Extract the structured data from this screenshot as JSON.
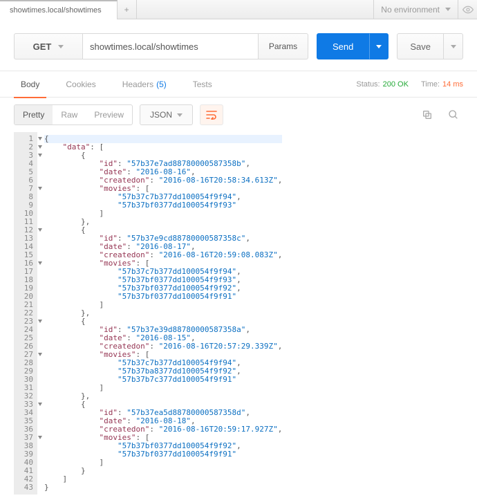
{
  "tab": {
    "title": "showtimes.local/showtimes"
  },
  "env": {
    "label": "No environment"
  },
  "request": {
    "method": "GET",
    "url": "showtimes.local/showtimes",
    "params": "Params",
    "send": "Send",
    "save": "Save"
  },
  "response_tabs": {
    "body": "Body",
    "cookies": "Cookies",
    "headers": "Headers",
    "headers_count": "(5)",
    "tests": "Tests"
  },
  "status": {
    "label": "Status:",
    "value": "200 OK",
    "time_label": "Time:",
    "time_value": "14 ms"
  },
  "viewer": {
    "pretty": "Pretty",
    "raw": "Raw",
    "preview": "Preview",
    "format": "JSON"
  },
  "payload": {
    "data": [
      {
        "id": "57b37e7ad88780000587358b",
        "date": "2016-08-16",
        "createdon": "2016-08-16T20:58:34.613Z",
        "movies": [
          "57b37c7b377dd100054f9f94",
          "57b37bf0377dd100054f9f93"
        ]
      },
      {
        "id": "57b37e9cd88780000587358c",
        "date": "2016-08-17",
        "createdon": "2016-08-16T20:59:08.083Z",
        "movies": [
          "57b37c7b377dd100054f9f94",
          "57b37bf0377dd100054f9f93",
          "57b37bf0377dd100054f9f92",
          "57b37bf0377dd100054f9f91"
        ]
      },
      {
        "id": "57b37e39d88780000587358a",
        "date": "2016-08-15",
        "createdon": "2016-08-16T20:57:29.339Z",
        "movies": [
          "57b37c7b377dd100054f9f94",
          "57b37ba8377dd100054f9f92",
          "57b37b7c377dd100054f9f91"
        ]
      },
      {
        "id": "57b37ea5d88780000587358d",
        "date": "2016-08-18",
        "createdon": "2016-08-16T20:59:17.927Z",
        "movies": [
          "57b37bf0377dd100054f9f92",
          "57b37bf0377dd100054f9f91"
        ]
      }
    ]
  }
}
